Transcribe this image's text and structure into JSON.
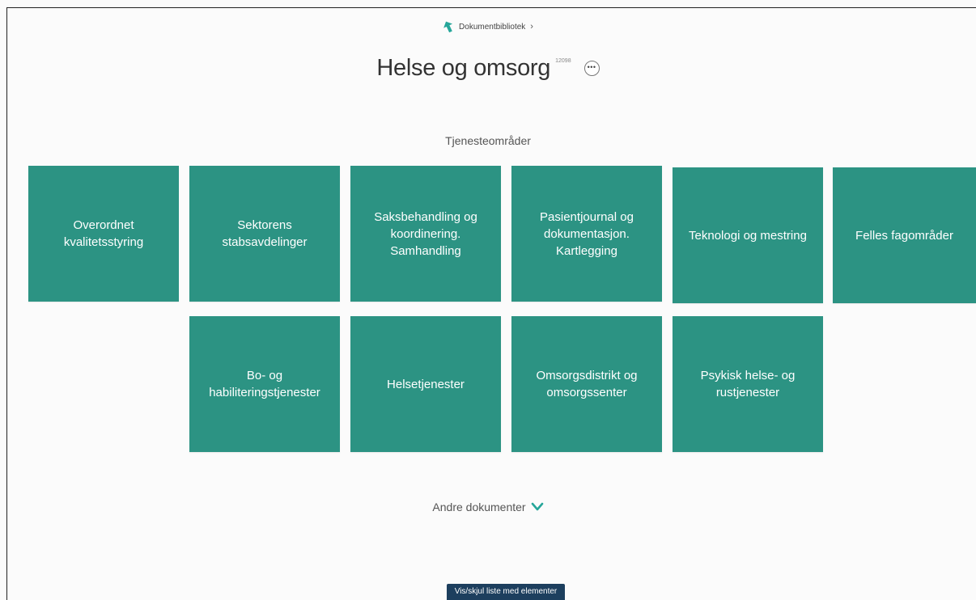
{
  "breadcrumb": {
    "link_label": "Dokumentbibliotek",
    "separator": "›"
  },
  "header": {
    "title": "Helse og omsorg",
    "count": "12098",
    "more_label": "•••"
  },
  "section": {
    "heading": "Tjenesteområder"
  },
  "tiles": [
    {
      "label": "Overordnet\nkvalitetsstyring"
    },
    {
      "label": "Sektorens\nstabsavdelinger"
    },
    {
      "label": "Saksbehandling og\nkoordinering.\nSamhandling"
    },
    {
      "label": "Pasientjournal og\ndokumentasjon.\nKartlegging"
    },
    {
      "label": "Teknologi og mestring"
    },
    {
      "label": "Felles fagområder"
    },
    {
      "label": "Bo- og\nhabiliteringstjenester"
    },
    {
      "label": "Helsetjenester"
    },
    {
      "label": "Omsorgsdistrikt og\nomsorgssenter"
    },
    {
      "label": "Psykisk helse- og\nrustjenester"
    }
  ],
  "other_documents": {
    "label": "Andre dokumenter"
  },
  "toggle_list": {
    "label": "Vis/skjul liste med elementer"
  },
  "icons": {
    "back": "back-arrow-icon",
    "expand": "chevron-down-icon",
    "more": "more-dots-icon"
  },
  "colors": {
    "tile": "#2c9383",
    "accent_icon": "#26a69a",
    "toggle_button": "#1d3f5e"
  }
}
